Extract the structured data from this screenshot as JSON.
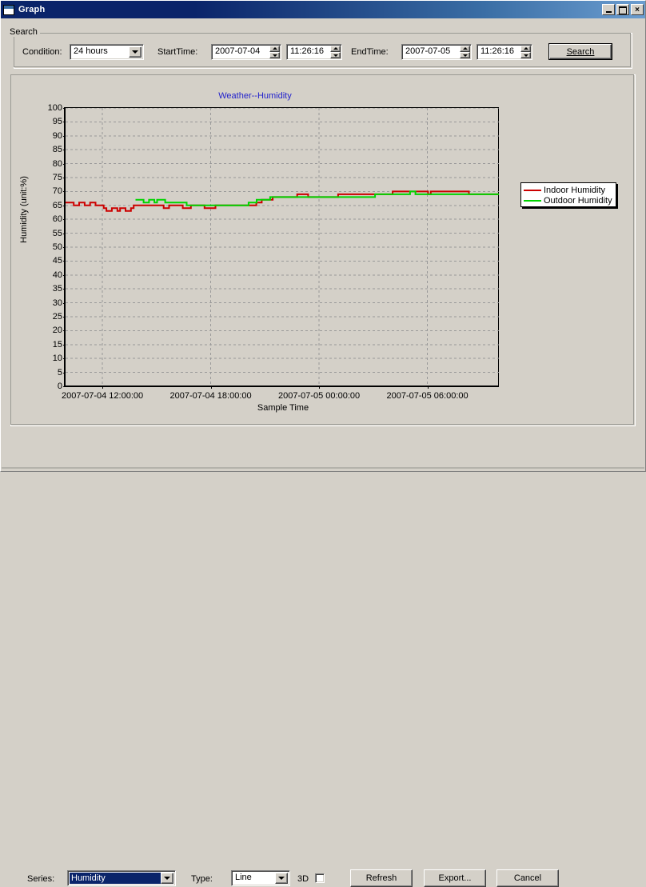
{
  "window": {
    "title": "Graph",
    "icon": "graph-window-icon",
    "minimize_label": "",
    "maximize_label": "",
    "close_label": "×"
  },
  "search": {
    "legend": "Search",
    "condition_label": "Condition:",
    "condition_value": "24 hours",
    "starttime_label": "StartTime:",
    "starttime_date": "2007-07-04",
    "starttime_time": "11:26:16",
    "endtime_label": "EndTime:",
    "endtime_date": "2007-07-05",
    "endtime_time": "11:26:16",
    "search_button": "Search",
    "search_button_accel": "S"
  },
  "bottom": {
    "series_label": "Series:",
    "series_value": "Humidity",
    "type_label": "Type:",
    "type_value": "Line",
    "threed_label": "3D",
    "refresh_button": "Refresh",
    "export_button": "Export...",
    "cancel_button": "Cancel"
  },
  "colors": {
    "indoor": "#cc0000",
    "outdoor": "#00d400",
    "title": "#2222cc",
    "face": "#d4d0c8",
    "grid": "#999999"
  },
  "chart_data": {
    "type": "line",
    "title": "Weather--Humidity",
    "xlabel": "Sample Time",
    "ylabel": "Humidity (unit:%)",
    "ylim": [
      0,
      100
    ],
    "yticks": [
      0,
      5,
      10,
      15,
      20,
      25,
      30,
      35,
      40,
      45,
      50,
      55,
      60,
      65,
      70,
      75,
      80,
      85,
      90,
      95,
      100
    ],
    "grid": true,
    "legend_position": "outside-right-top",
    "xticks": [
      "2007-07-04 12:00:00",
      "2007-07-04 18:00:00",
      "2007-07-05 00:00:00",
      "2007-07-05 06:00:00"
    ],
    "xtick_fractions": [
      0.085,
      0.335,
      0.585,
      0.835
    ],
    "x_range": [
      "2007-07-04 11:26:16",
      "2007-07-05 11:26:16"
    ],
    "series": [
      {
        "name": "Indoor Humidity",
        "color": "#cc0000",
        "values": [
          66,
          66,
          66,
          65,
          65,
          66,
          66,
          65,
          65,
          66,
          66,
          65,
          65,
          65,
          64,
          63,
          63,
          64,
          64,
          63,
          64,
          64,
          63,
          63,
          64,
          65,
          65,
          65,
          65,
          65,
          65,
          65,
          65,
          65,
          65,
          65,
          64,
          64,
          65,
          65,
          65,
          65,
          65,
          64,
          64,
          64,
          65,
          65,
          65,
          65,
          65,
          64,
          64,
          64,
          64,
          65,
          65,
          65,
          65,
          65,
          65,
          65,
          65,
          65,
          65,
          65,
          65,
          65,
          65,
          65,
          66,
          66,
          67,
          67,
          67,
          67,
          68,
          68,
          68,
          68,
          68,
          68,
          68,
          68,
          68,
          69,
          69,
          69,
          69,
          68,
          68,
          68,
          68,
          68,
          68,
          68,
          68,
          68,
          68,
          68,
          69,
          69,
          69,
          69,
          69,
          69,
          69,
          69,
          69,
          69,
          69,
          69,
          69,
          69,
          69,
          69,
          69,
          69,
          69,
          69,
          70,
          70,
          70,
          70,
          70,
          70,
          70,
          70,
          70,
          70,
          70,
          70,
          70,
          69,
          70,
          70,
          70,
          70,
          70,
          70,
          70,
          70,
          70,
          70,
          70,
          70,
          70,
          70,
          69,
          69,
          69,
          69,
          69,
          69,
          69,
          69,
          69,
          69,
          69,
          69
        ]
      },
      {
        "name": "Outdoor Humidity",
        "color": "#00d400",
        "values": [
          null,
          null,
          null,
          null,
          null,
          null,
          null,
          null,
          null,
          null,
          null,
          null,
          null,
          null,
          null,
          null,
          null,
          null,
          null,
          null,
          null,
          null,
          null,
          null,
          null,
          null,
          67,
          67,
          67,
          66,
          66,
          67,
          67,
          66,
          67,
          67,
          67,
          66,
          66,
          66,
          66,
          66,
          66,
          66,
          66,
          65,
          65,
          65,
          65,
          65,
          65,
          65,
          65,
          65,
          65,
          65,
          65,
          65,
          65,
          65,
          65,
          65,
          65,
          65,
          65,
          65,
          65,
          65,
          66,
          66,
          66,
          67,
          67,
          67,
          67,
          67,
          68,
          68,
          68,
          68,
          68,
          68,
          68,
          68,
          68,
          68,
          68,
          68,
          68,
          68,
          68,
          68,
          68,
          68,
          68,
          68,
          68,
          68,
          68,
          68,
          68,
          68,
          68,
          68,
          68,
          68,
          68,
          68,
          68,
          68,
          68,
          68,
          68,
          68,
          68,
          69,
          69,
          69,
          69,
          69,
          69,
          69,
          69,
          69,
          69,
          69,
          69,
          69,
          70,
          70,
          69,
          69,
          69,
          69,
          69,
          69,
          69,
          69,
          69,
          69,
          69,
          69,
          69,
          69,
          69,
          69,
          69,
          69,
          69,
          69,
          69,
          69,
          69,
          69,
          69,
          69,
          69,
          69,
          69,
          69,
          69,
          69
        ]
      }
    ]
  }
}
